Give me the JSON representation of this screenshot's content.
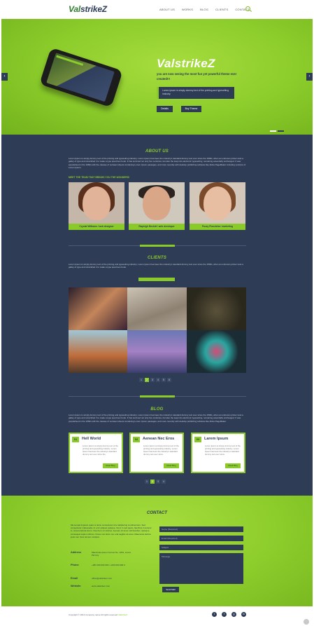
{
  "brand": {
    "part1": "Val",
    "part2": "strikeZ"
  },
  "nav": [
    "ABOUT US",
    "WORKS",
    "BLOG",
    "CLIENTS",
    "CONTACT"
  ],
  "hero": {
    "title": "ValstrikeZ",
    "subtitle": "you are now seeing the most fun yet powerful theme ever created!!!",
    "quote": "Lorem Ipsum is simply dummy text of the printing and typesetting industry.",
    "btn_primary": "Details",
    "btn_secondary": "Buy Theme",
    "prev_arrow": "‹",
    "next_arrow": "›"
  },
  "about": {
    "title": "ABOUT US",
    "text": "Lorem Ipsum is simply dummy text of the printing and typesetting industry. Lorem Ipsum has been the industry's standard dummy text ever since the 1500s, when an unknown printer took a galley of type and scrambled it to make a type specimen book. It has survived not only five centuries, but also the leap into electronic typesetting, remaining essentially unchanged. It was popularised in the 1960s with the release of Letraset sheets containing Lorem Ipsum passages, and more recently with desktop publishing software like Aldus PageMaker including versions of Lorem Ipsum.",
    "meet_label": "MEET THE TEAM THAT BRINGS YOU THE WONDERS!",
    "team": [
      {
        "caption": "Crystal Williams / web designer"
      },
      {
        "caption": "Rayleigh Beckitt / web developer"
      },
      {
        "caption": "Puzzy Flonzisha / marketing"
      }
    ]
  },
  "clients": {
    "title": "CLIENTS",
    "text": "Lorem Ipsum is simply dummy text of the printing and typesetting industry. Lorem Ipsum has been the industry's standard dummy text ever since the 1500s, when an unknown printer took a galley of type and scrambled it to make a type specimen book.",
    "pages": [
      "1",
      "2",
      "3",
      "4",
      "5",
      "6"
    ],
    "active_page": "2"
  },
  "blog": {
    "title": "BLOG",
    "text": "Lorem Ipsum is simply dummy text of the printing and typesetting industry. Lorem Ipsum has been the industry's standard dummy text ever since the 1500s, when an unknown printer took a galley of type and scrambled it to make a type specimen book. It has survived not only five centuries, but also the leap into electronic typesetting, remaining essentially unchanged. It was popularised in the 1960s with the release of Letraset sheets containing Lorem Ipsum passages, and more recently with desktop publishing software like Aldus PageMaker.",
    "posts": [
      {
        "num": "01",
        "title": "Hell World",
        "excerpt": "Lorem Ipsum is simply dummy text of the printing and typesetting industry. Lorem Ipsum has been the industry's standard dummy text ever since the.",
        "more": "Read Blog"
      },
      {
        "num": "02",
        "title": "Aenean Nec Eros",
        "excerpt": "Lorem Ipsum is simply dummy text of the printing and typesetting industry. Lorem Ipsum has been the industry's standard dummy text ever since.",
        "more": "Read Blog"
      },
      {
        "num": "03",
        "title": "Larem Ipsum",
        "excerpt": "Lorem Ipsum is simply dummy text of the printing and typesetting industry. Lorem Ipsum has been the industry's standard dummy text ever since.",
        "more": "Read Blog"
      }
    ],
    "pages": [
      "1",
      "2",
      "3",
      "4"
    ],
    "active_page": "2"
  },
  "contact": {
    "title": "CONTACT",
    "text": "Ma senpai tinputun quam a lacus consectetur id et adipiscing condimentum. Sed consectetur malesuada. In enim aliquet quisque. Nunc in sed quam, faucibus in tempor in, cursus lacinia lorem. Viverra in mi ultrices. Aenean sit amet nisl faucibus. Quisque consequat sapien ultrices. Donec vel dolor non erat sagittis sit amet. Maecenas lacinia justo nec risus tempor volutpat.",
    "address_label": "Address",
    "address_value": "Maecenas ipsum Cursus No. 1234, Lorem Pid City",
    "phone_label": "Phone",
    "phone_value": "+381 000 000 000 / +000 000 000 0",
    "email_label": "Email",
    "email_value": "office@valstrikez.com",
    "website_label": "Website",
    "website_value": "www.valstrikez.com",
    "field_name": "Name (Required)",
    "field_email": "Email (Required)",
    "field_subject": "Subject",
    "field_message": "Message",
    "send": "Send Mail"
  },
  "footer": {
    "copyright": "Copyright © 2014 Company name All rights reserved",
    "credit": "ValstrikeZ",
    "socials": [
      "t",
      "f",
      "g",
      "in"
    ]
  },
  "colors": {
    "accent": "#8acb2a",
    "dark": "#2e3c55"
  }
}
